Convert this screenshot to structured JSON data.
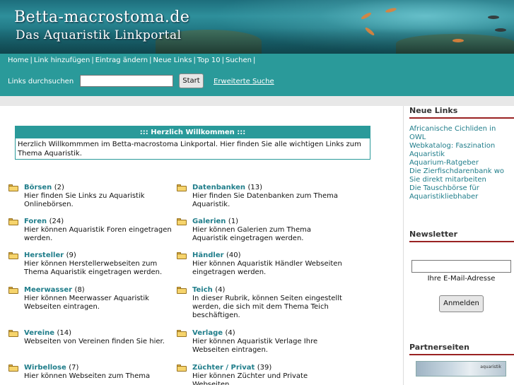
{
  "banner": {
    "title": "Betta-macrostoma.de",
    "subtitle": "Das Aquaristik Linkportal"
  },
  "nav": {
    "items": [
      "Home",
      "Link hinzufügen",
      "Eintrag ändern",
      "Neue Links",
      "Top 10",
      "Suchen"
    ]
  },
  "search": {
    "label": "Links durchsuchen",
    "input_value": "",
    "button": "Start",
    "advanced": "Erweiterte Suche"
  },
  "welcome": {
    "title": "::: Herzlich Willkommen :::",
    "text": "Herzlich Willkommmen im Betta-macrostoma Linkportal. Hier finden Sie alle wichtigen Links zum Thema Aquaristik."
  },
  "categories": [
    {
      "name": "Börsen",
      "count": "(2)",
      "desc": "Hier finden Sie Links zu Aquaristik Onlinebörsen."
    },
    {
      "name": "Datenbanken",
      "count": "(13)",
      "desc": "Hier finden Sie Datenbanken zum Thema Aquaristik."
    },
    {
      "name": "Foren",
      "count": "(24)",
      "desc": "Hier können Aquaristik Foren eingetragen werden."
    },
    {
      "name": "Galerien",
      "count": "(1)",
      "desc": "Hier können Galerien zum Thema Aquaristik eingetragen werden."
    },
    {
      "name": "Hersteller",
      "count": "(9)",
      "desc": "Hier können Herstellerwebseiten zum Thema Aquaristik eingetragen werden."
    },
    {
      "name": "Händler",
      "count": "(40)",
      "desc": "Hier können Aquaristik Händler Webseiten eingetragen werden."
    },
    {
      "name": "Meerwasser",
      "count": "(8)",
      "desc": "Hier können Meerwasser Aquaristik Webseiten eintragen."
    },
    {
      "name": "Teich",
      "count": "(4)",
      "desc": "In dieser Rubrik, können Seiten eingestellt werden, die sich mit dem Thema Teich beschäftigen."
    },
    {
      "name": "Vereine",
      "count": "(14)",
      "desc": "Webseiten von Vereinen finden Sie hier."
    },
    {
      "name": "Verlage",
      "count": "(4)",
      "desc": "Hier können Aquaristik Verlage Ihre Webseiten eintragen."
    },
    {
      "name": "Wirbellose",
      "count": "(7)",
      "desc": "Hier können Webseiten zum Thema"
    },
    {
      "name": "Züchter / Privat",
      "count": "(39)",
      "desc": "Hier können Züchter und Private Webseiten"
    }
  ],
  "sidebar": {
    "new_links_title": "Neue Links",
    "new_links": [
      "Africanische Cichliden in OWL",
      "Webkatalog: Faszination Aquaristik",
      "Aquarium-Ratgeber",
      "Die Zierfischdarenbank wo Sie direkt mitarbeiten",
      "Die Tauschbörse für Aquaristikliebhaber"
    ],
    "newsletter_title": "Newsletter",
    "newsletter_input": "",
    "newsletter_label": "Ihre E-Mail-Adresse",
    "newsletter_button": "Anmelden",
    "partner_title": "Partnerseiten",
    "partner_text": "aquaristik"
  },
  "colors": {
    "teal": "#2a9a9a",
    "link": "#1f7d8a",
    "accent_red": "#9a2222"
  }
}
